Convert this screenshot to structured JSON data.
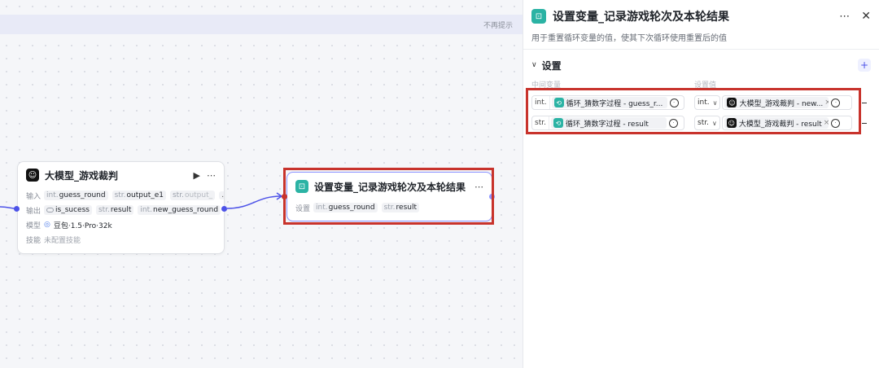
{
  "banner": {
    "text": "不再提示"
  },
  "node_llm": {
    "title": "大模型_游戏裁判",
    "input_label": "输入",
    "inputs": [
      {
        "type": "int.",
        "name": "guess_round"
      },
      {
        "type": "str.",
        "name": "output_e1"
      },
      {
        "type": "str.",
        "name": "output_"
      }
    ],
    "input_more": "…",
    "output_label": "输出",
    "outputs": [
      {
        "type": "",
        "name": "is_sucess"
      },
      {
        "type": "str.",
        "name": "result"
      },
      {
        "type": "int.",
        "name": "new_guess_round"
      }
    ],
    "model_label": "模型",
    "model_value": "豆包·1.5·Pro·32k",
    "skill_label": "技能",
    "skill_value": "未配置技能"
  },
  "node_setvar": {
    "title": "设置变量_记录游戏轮次及本轮结果",
    "set_label": "设置",
    "vars": [
      {
        "type": "int.",
        "name": "guess_round"
      },
      {
        "type": "str.",
        "name": "result"
      }
    ]
  },
  "panel": {
    "title": "设置变量_记录游戏轮次及本轮结果",
    "description": "用于重置循环变量的值，使其下次循环使用重置后的值",
    "section_title": "设置",
    "col_left": "中间变量",
    "col_right": "设置值",
    "rows": [
      {
        "left_type": "int.",
        "left_ref": "循环_猜数字过程 - guess_r...",
        "right_type": "int.",
        "right_ref": "大模型_游戏裁判 - new..."
      },
      {
        "left_type": "str.",
        "left_ref": "循环_猜数字过程 - result",
        "right_type": "str.",
        "right_ref": "大模型_游戏裁判 - result"
      }
    ]
  },
  "icons": {
    "more": "more-horizontal-icon",
    "close": "close-icon",
    "play": "play-icon",
    "chevron": "chevron-down-icon",
    "add": "plus-icon"
  }
}
